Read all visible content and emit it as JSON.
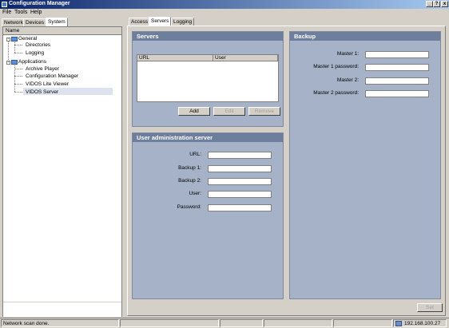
{
  "window": {
    "title": "Configuration Manager"
  },
  "menu": [
    "File",
    "Tools",
    "Help"
  ],
  "left_tabs": [
    "Network",
    "Devices",
    "System"
  ],
  "tree": {
    "column_header": "Name",
    "general": {
      "label": "General",
      "children": [
        "Directories",
        "Logging"
      ]
    },
    "applications": {
      "label": "Applications",
      "children": [
        "Archive Player",
        "Configuration Manager",
        "VIDOS Lite Viewer",
        "VIDOS Server"
      ]
    }
  },
  "right_tabs": [
    "Access",
    "Servers",
    "Logging"
  ],
  "servers_panel": {
    "title": "Servers",
    "columns": [
      "URL",
      "User"
    ],
    "buttons": {
      "add": "Add",
      "edit": "Edit",
      "remove": "Remove"
    }
  },
  "user_admin_panel": {
    "title": "User administration server",
    "fields": [
      {
        "label": "URL:",
        "value": ""
      },
      {
        "label": "Backup 1:",
        "value": ""
      },
      {
        "label": "Backup 2:",
        "value": ""
      },
      {
        "label": "User:",
        "value": ""
      },
      {
        "label": "Password:",
        "value": ""
      }
    ]
  },
  "backup_panel": {
    "title": "Backup",
    "fields": [
      {
        "label": "Master 1:",
        "value": ""
      },
      {
        "label": "Master 1 password:",
        "value": ""
      },
      {
        "label": "Master 2:",
        "value": ""
      },
      {
        "label": "Master 2 password:",
        "value": ""
      }
    ]
  },
  "set_button": "Set",
  "status": {
    "message": "Network scan done.",
    "ip": "192.168.100.27"
  },
  "colors": {
    "panel_bg": "#a5b2c7",
    "panel_header": "#6d7f9c",
    "title_start": "#0a246a"
  }
}
